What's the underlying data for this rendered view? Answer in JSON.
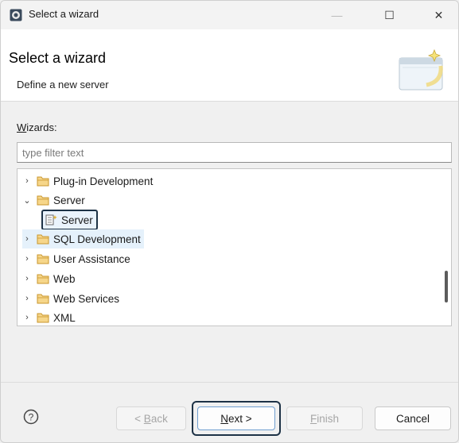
{
  "window": {
    "title": "Select a wizard",
    "minimize_label": "—",
    "maximize_label": "☐",
    "close_label": "✕"
  },
  "header": {
    "title": "Select a wizard",
    "description": "Define a new server"
  },
  "wizards": {
    "label_mnemonic": "W",
    "label_rest": "izards:",
    "filter_placeholder": "type filter text",
    "filter_value": ""
  },
  "tree": {
    "items": [
      {
        "label": "Plug-in Development",
        "expanded": false
      },
      {
        "label": "Server",
        "expanded": true
      },
      {
        "label": "Server",
        "child": true,
        "selected": true
      },
      {
        "label": "SQL Development",
        "expanded": false,
        "highlighted": true
      },
      {
        "label": "User Assistance",
        "expanded": false
      },
      {
        "label": "Web",
        "expanded": false
      },
      {
        "label": "Web Services",
        "expanded": false
      },
      {
        "label": "XML",
        "expanded": false
      }
    ]
  },
  "buttons": {
    "back_prefix": "< ",
    "back_mnemonic": "B",
    "back_rest": "ack",
    "next_mnemonic": "N",
    "next_rest": "ext >",
    "finish_mnemonic": "F",
    "finish_rest": "inish",
    "cancel": "Cancel",
    "help_icon": "?"
  },
  "colors": {
    "accent_outline": "#1d3246",
    "folder": "#d7a33a",
    "next_border": "#6f9ed0"
  }
}
